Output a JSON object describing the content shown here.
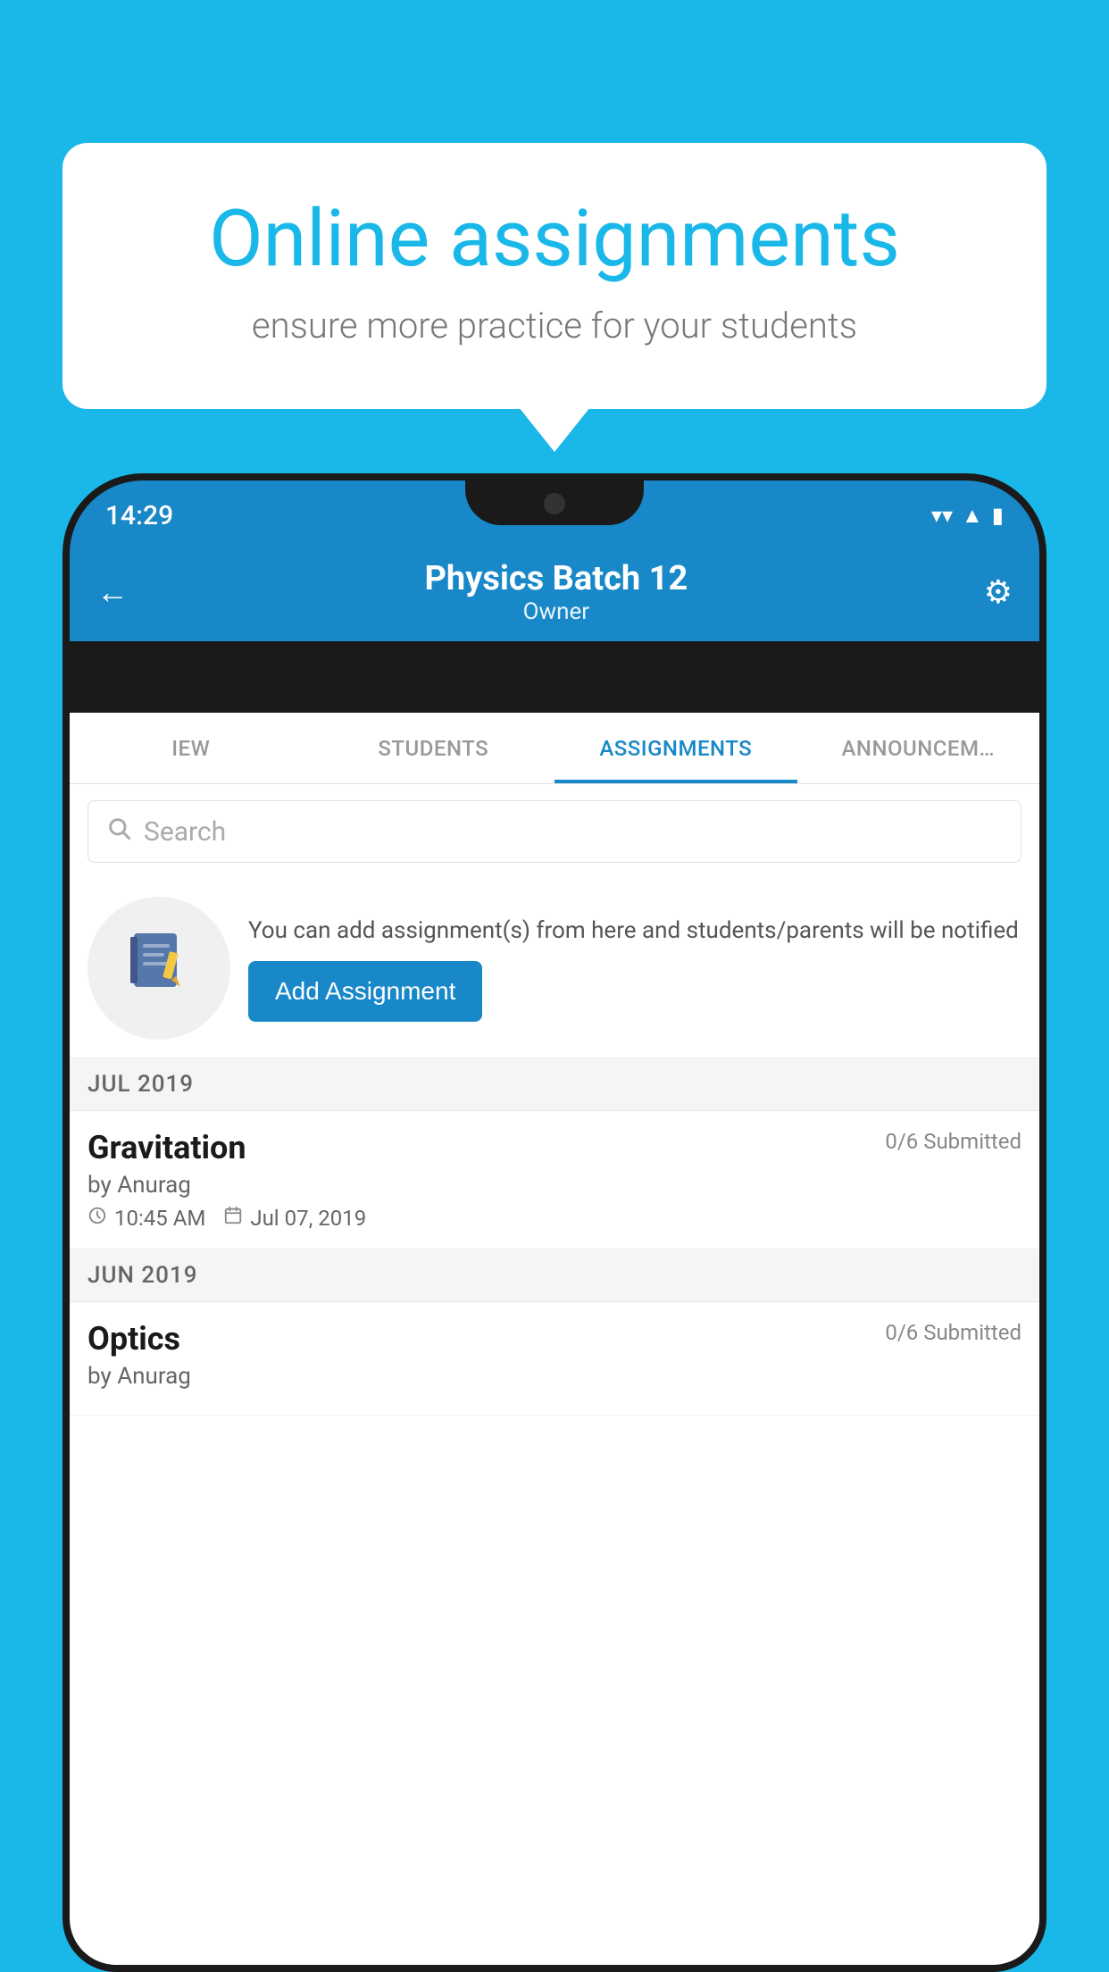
{
  "background": {
    "color": "#1ab8e8"
  },
  "speech_bubble": {
    "title": "Online assignments",
    "subtitle": "ensure more practice for your students"
  },
  "status_bar": {
    "time": "14:29",
    "wifi": "▼",
    "signal": "▲",
    "battery": "▮"
  },
  "header": {
    "title": "Physics Batch 12",
    "subtitle": "Owner",
    "back_label": "←",
    "settings_label": "⚙"
  },
  "tabs": [
    {
      "label": "IEW",
      "active": false
    },
    {
      "label": "STUDENTS",
      "active": false
    },
    {
      "label": "ASSIGNMENTS",
      "active": true
    },
    {
      "label": "ANNOUNCEM…",
      "active": false
    }
  ],
  "search": {
    "placeholder": "Search"
  },
  "promo": {
    "description": "You can add assignment(s) from here and students/parents will be notified",
    "button_label": "Add Assignment"
  },
  "assignment_groups": [
    {
      "month": "JUL 2019",
      "assignments": [
        {
          "name": "Gravitation",
          "submitted": "0/6 Submitted",
          "by": "by Anurag",
          "time": "10:45 AM",
          "date": "Jul 07, 2019"
        }
      ]
    },
    {
      "month": "JUN 2019",
      "assignments": [
        {
          "name": "Optics",
          "submitted": "0/6 Submitted",
          "by": "by Anurag",
          "time": "",
          "date": ""
        }
      ]
    }
  ]
}
